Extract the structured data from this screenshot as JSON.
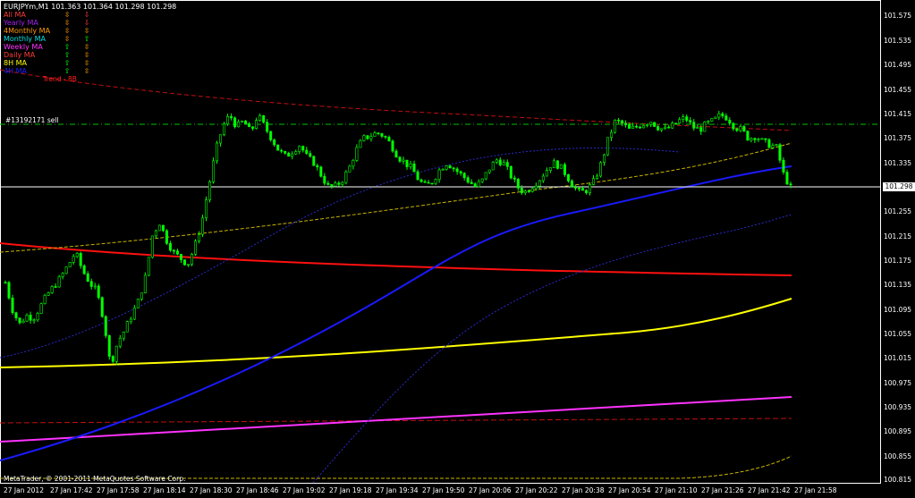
{
  "header": {
    "symbol": "EURJPYm,M1",
    "open": "101.363",
    "high": "101.364",
    "low": "101.298",
    "close": "101.298"
  },
  "legend": [
    {
      "name": "All MA",
      "color": "#ff3b3b",
      "icons": [
        "neutral",
        "down"
      ]
    },
    {
      "name": "Yearly MA",
      "color": "#a020f0",
      "icons": [
        "neutral",
        "down"
      ]
    },
    {
      "name": "4Monthly MA",
      "color": "#ff9900",
      "icons": [
        "neutral",
        "neutral"
      ]
    },
    {
      "name": "Monthly MA",
      "color": "#00e0e0",
      "icons": [
        "neutral",
        "up"
      ]
    },
    {
      "name": "Weekly MA",
      "color": "#ff33ff",
      "icons": [
        "up",
        "neutral"
      ]
    },
    {
      "name": "Daily MA",
      "color": "#ff3b3b",
      "icons": [
        "up",
        "neutral"
      ]
    },
    {
      "name": "8H MA",
      "color": "#ffff00",
      "icons": [
        "up",
        "neutral"
      ]
    },
    {
      "name": "4H MA",
      "color": "#2020ff",
      "icons": [
        "up",
        "neutral"
      ]
    }
  ],
  "annotations": {
    "trend_label": "Trend - 8B",
    "order_label": "#13192171 sell",
    "copyright": "MetaTrader, © 2001-2011 MetaQuotes Software Corp."
  },
  "colors": {
    "background": "#000000",
    "candle": "#00ff00",
    "last_price_line": "#ffffff",
    "order_line": "#00c000"
  },
  "chart_data": {
    "type": "candlestick",
    "instrument": "EURJPYm",
    "timeframe": "M1",
    "current_price": "101.298",
    "order_price": 101.398,
    "y_ticks": [
      "101.575",
      "101.535",
      "101.495",
      "101.455",
      "101.415",
      "101.375",
      "101.335",
      "101.298",
      "101.255",
      "101.215",
      "101.175",
      "101.135",
      "101.095",
      "101.055",
      "101.015",
      "100.975",
      "100.935",
      "100.895",
      "100.855",
      "100.815"
    ],
    "x_ticks": [
      "27 Jan 2012",
      "27 Jan 17:42",
      "27 Jan 17:58",
      "27 Jan 18:14",
      "27 Jan 18:30",
      "27 Jan 18:46",
      "27 Jan 19:02",
      "27 Jan 19:18",
      "27 Jan 19:34",
      "27 Jan 19:50",
      "27 Jan 20:06",
      "27 Jan 20:22",
      "27 Jan 20:38",
      "27 Jan 20:54",
      "27 Jan 21:10",
      "27 Jan 21:26",
      "27 Jan 21:42",
      "27 Jan 21:58"
    ],
    "y_range": [
      100.805,
      101.6
    ],
    "close_path": [
      101.14,
      101.095,
      101.07,
      101.085,
      101.08,
      101.1,
      101.12,
      101.135,
      101.15,
      101.17,
      101.19,
      101.16,
      101.14,
      101.125,
      101.08,
      101.0,
      101.04,
      101.06,
      101.085,
      101.11,
      101.15,
      101.22,
      101.24,
      101.21,
      101.19,
      101.18,
      101.17,
      101.2,
      101.24,
      101.3,
      101.36,
      101.4,
      101.42,
      101.4,
      101.41,
      101.39,
      101.42,
      101.4,
      101.38,
      101.36,
      101.35,
      101.36,
      101.37,
      101.35,
      101.34,
      101.32,
      101.3,
      101.3,
      101.31,
      101.33,
      101.36,
      101.38,
      101.385,
      101.39,
      101.385,
      101.37,
      101.35,
      101.34,
      101.33,
      101.31,
      101.3,
      101.31,
      101.33,
      101.34,
      101.33,
      101.32,
      101.31,
      101.3,
      101.31,
      101.33,
      101.345,
      101.34,
      101.32,
      101.3,
      101.29,
      101.3,
      101.31,
      101.325,
      101.34,
      101.335,
      101.32,
      101.3,
      101.29,
      101.295,
      101.31,
      101.34,
      101.38,
      101.41,
      101.405,
      101.395,
      101.4,
      101.405,
      101.41,
      101.4,
      101.395,
      101.4,
      101.41,
      101.415,
      101.4,
      101.395,
      101.405,
      101.41,
      101.42,
      101.415,
      101.4,
      101.395,
      101.38,
      101.385,
      101.375,
      101.37,
      101.365,
      101.32,
      101.298
    ]
  }
}
